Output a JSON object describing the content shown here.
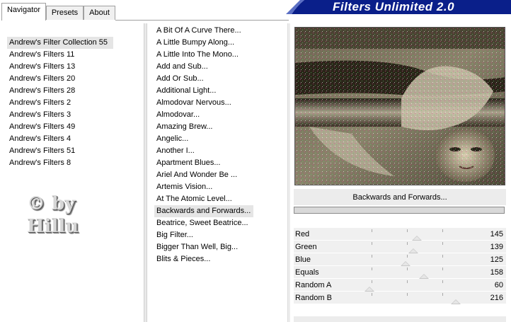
{
  "tabs": [
    {
      "label": "Navigator",
      "active": true
    },
    {
      "label": "Presets",
      "active": false
    },
    {
      "label": "About",
      "active": false
    }
  ],
  "banner": {
    "title": "Filters Unlimited 2.0",
    "color": "#0a1f8a"
  },
  "categories": {
    "selected_index": 0,
    "items": [
      "Andrew's Filter Collection 55",
      "Andrew's Filters 11",
      "Andrew's Filters 13",
      "Andrew's Filters 20",
      "Andrew's Filters 28",
      "Andrew's Filters 2",
      "Andrew's Filters 3",
      "Andrew's Filters 49",
      "Andrew's Filters 4",
      "Andrew's Filters 51",
      "Andrew's Filters 8"
    ]
  },
  "watermark": {
    "line1": "© by",
    "line2": "Hillu"
  },
  "filters": {
    "selected_index": 15,
    "items": [
      "A Bit Of A Curve There...",
      "A Little Bumpy Along...",
      "A Little Into The Mono...",
      "Add and Sub...",
      "Add Or Sub...",
      "Additional Light...",
      "Almodovar Nervous...",
      "Almodovar...",
      "Amazing Brew...",
      "Angelic...",
      "Another I...",
      "Apartment Blues...",
      "Ariel And Wonder Be ...",
      "Artemis Vision...",
      "At The Atomic Level...",
      "Backwards and Forwards...",
      "Beatrice, Sweet Beatrice...",
      "Big Filter...",
      "Bigger Than Well, Big...",
      "Blits & Pieces..."
    ]
  },
  "preview": {
    "filter_name": "Backwards and Forwards...",
    "progress": 0
  },
  "sliders": [
    {
      "label": "Red",
      "value": "145",
      "level": 145
    },
    {
      "label": "Green",
      "value": "139",
      "level": 139
    },
    {
      "label": "Blue",
      "value": "125",
      "level": 125
    },
    {
      "label": "Equals",
      "value": "158",
      "level": 158
    },
    {
      "label": "Random A",
      "value": "60",
      "level": 60
    },
    {
      "label": "Random B",
      "value": "216",
      "level": 216
    }
  ],
  "slider_max": 255
}
